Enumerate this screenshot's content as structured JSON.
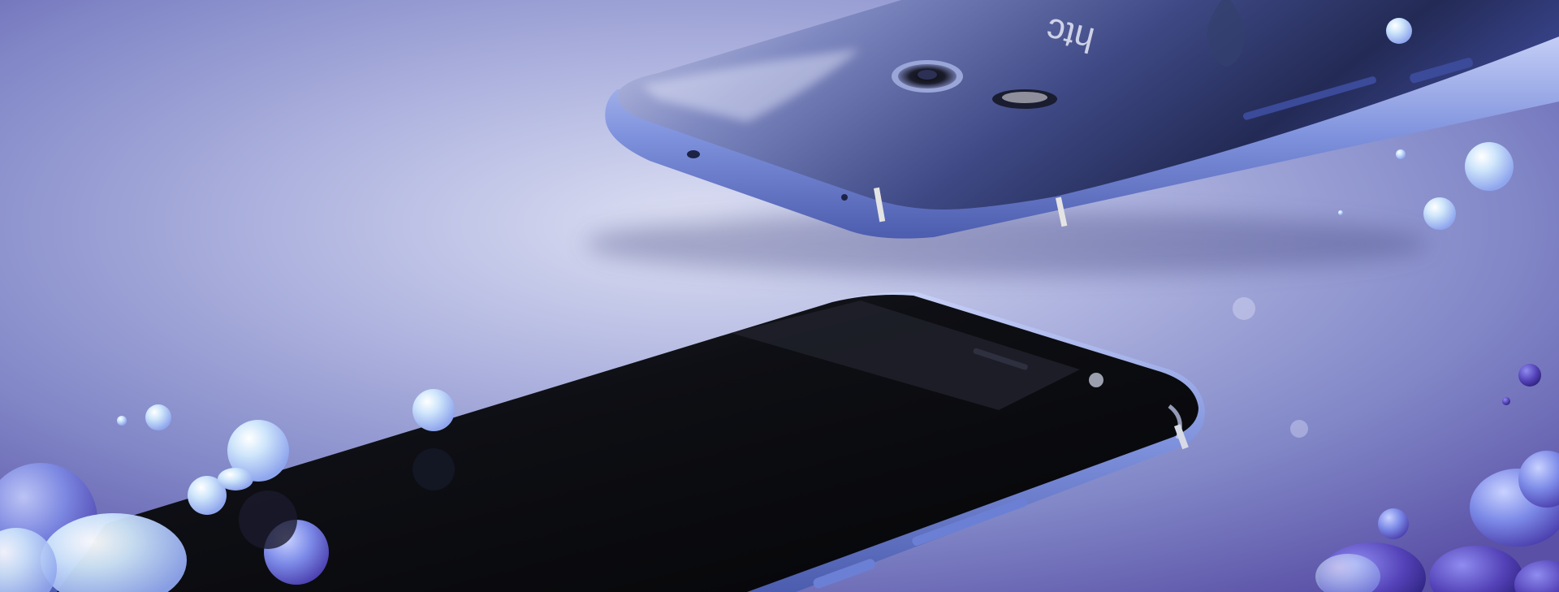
{
  "image": {
    "kind": "product-photo",
    "logo_text": "htc",
    "colors": {
      "background_light": "#d9dcf0",
      "background_mid": "#8f93d0",
      "background_dark": "#5a4fa3",
      "phone_back_blue": "#5d6fc2",
      "phone_back_dark": "#2c3568",
      "phone_frame": "#8e9fe2",
      "phone_front_black": "#0b0c10",
      "bubble_light": "#cfe6fb",
      "bubble_blue": "#7d8be8",
      "bubble_deep": "#4e3fb1"
    }
  }
}
